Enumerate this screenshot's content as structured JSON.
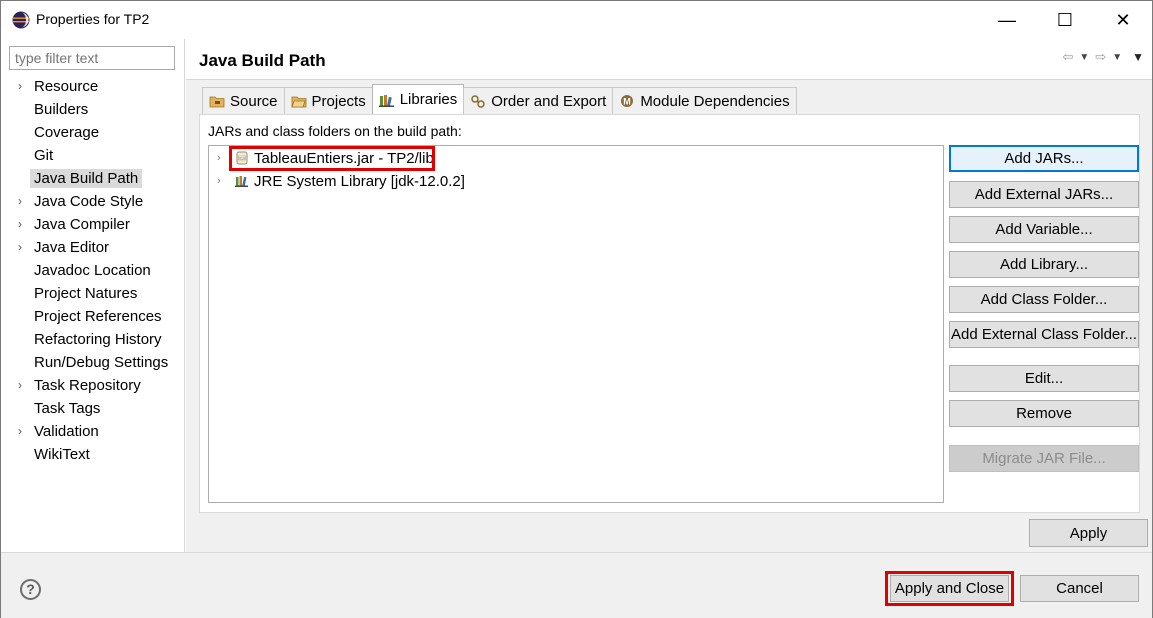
{
  "window": {
    "title": "Properties for TP2",
    "minimize_glyph": "—",
    "maximize_glyph": "☐",
    "close_glyph": "✕"
  },
  "left_pane": {
    "filter_placeholder": "type filter text",
    "items": [
      {
        "label": "Resource",
        "expandable": true
      },
      {
        "label": "Builders",
        "expandable": false
      },
      {
        "label": "Coverage",
        "expandable": false
      },
      {
        "label": "Git",
        "expandable": false
      },
      {
        "label": "Java Build Path",
        "expandable": false,
        "selected": true
      },
      {
        "label": "Java Code Style",
        "expandable": true
      },
      {
        "label": "Java Compiler",
        "expandable": true
      },
      {
        "label": "Java Editor",
        "expandable": true
      },
      {
        "label": "Javadoc Location",
        "expandable": false
      },
      {
        "label": "Project Natures",
        "expandable": false
      },
      {
        "label": "Project References",
        "expandable": false
      },
      {
        "label": "Refactoring History",
        "expandable": false
      },
      {
        "label": "Run/Debug Settings",
        "expandable": false
      },
      {
        "label": "Task Repository",
        "expandable": true
      },
      {
        "label": "Task Tags",
        "expandable": false
      },
      {
        "label": "Validation",
        "expandable": true
      },
      {
        "label": "WikiText",
        "expandable": false
      }
    ]
  },
  "page": {
    "title": "Java Build Path",
    "tabs": [
      {
        "label": "Source",
        "icon": "source-folder-icon"
      },
      {
        "label": "Projects",
        "icon": "projects-folder-icon"
      },
      {
        "label": "Libraries",
        "icon": "libraries-icon",
        "active": true
      },
      {
        "label": "Order and Export",
        "icon": "order-export-icon"
      },
      {
        "label": "Module Dependencies",
        "icon": "module-icon"
      }
    ],
    "build_path_label": "JARs and class folders on the build path:",
    "libraries": [
      {
        "label": "TableauEntiers.jar - TP2/lib",
        "icon": "jar-icon",
        "highlighted": true
      },
      {
        "label": "JRE System Library [jdk-12.0.2]",
        "icon": "library-icon",
        "highlighted": false
      }
    ],
    "buttons": {
      "add_jars": "Add JARs...",
      "add_external_jars": "Add External JARs...",
      "add_variable": "Add Variable...",
      "add_library": "Add Library...",
      "add_class_folder": "Add Class Folder...",
      "add_external_class_folder": "Add External Class Folder...",
      "edit": "Edit...",
      "remove": "Remove",
      "migrate_jar": "Migrate JAR File..."
    },
    "apply": "Apply"
  },
  "footer": {
    "help_glyph": "?",
    "apply_and_close": "Apply and Close",
    "cancel": "Cancel"
  },
  "colors": {
    "annotation_red": "#e00000",
    "focus_blue": "#0078d7"
  }
}
